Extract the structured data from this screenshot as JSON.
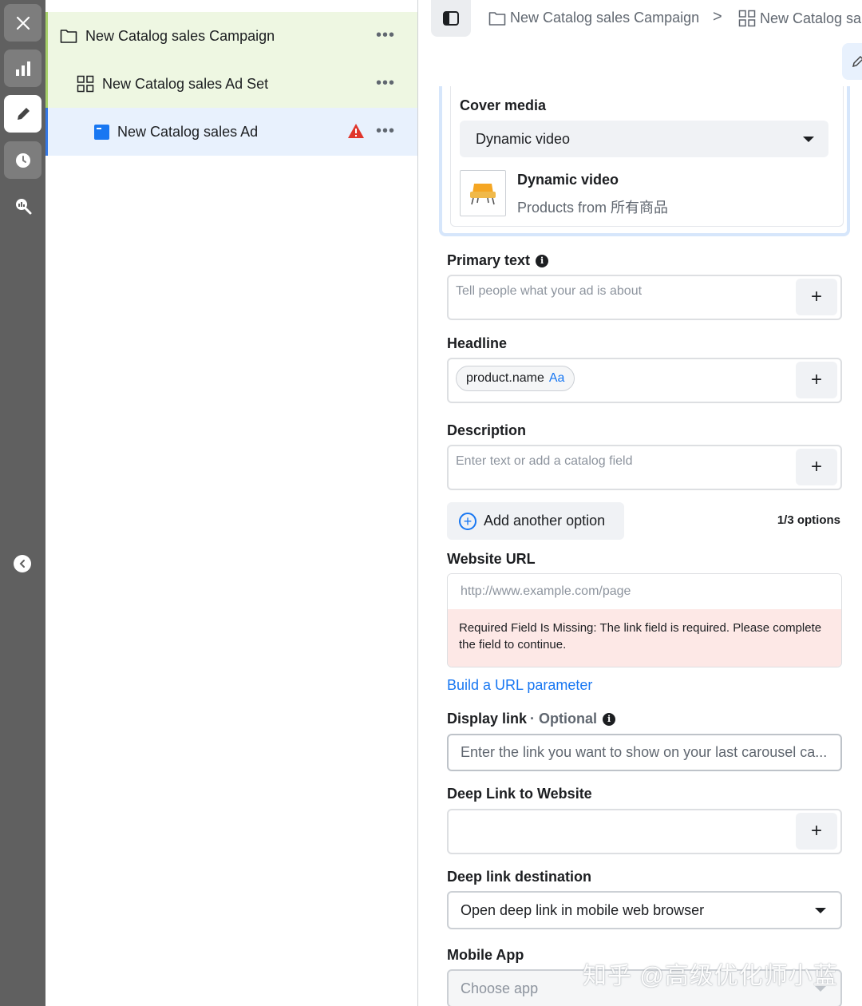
{
  "rail": {
    "items": [
      "close",
      "reporting",
      "edit",
      "history",
      "review"
    ]
  },
  "tree": {
    "campaign": {
      "label": "New Catalog sales Campaign",
      "more": "•••"
    },
    "adset": {
      "label": "New Catalog sales Ad Set",
      "more": "•••"
    },
    "ad": {
      "label": "New Catalog sales Ad",
      "more": "•••",
      "status": "error"
    }
  },
  "breadcrumb": {
    "campaign": "New Catalog sales Campaign",
    "separator": ">",
    "adset": "New Catalog sa"
  },
  "cover_media": {
    "label": "Cover media",
    "selected": "Dynamic video",
    "preview_title": "Dynamic video",
    "preview_subtitle": "Products from 所有商品"
  },
  "primary_text": {
    "label": "Primary text",
    "placeholder": "Tell people what your ad is about",
    "add": "+"
  },
  "headline": {
    "label": "Headline",
    "token": "product.name",
    "token_suffix": "Aa",
    "add": "+"
  },
  "description": {
    "label": "Description",
    "placeholder": "Enter text or add a catalog field",
    "add": "+"
  },
  "options": {
    "add_label": "Add another option",
    "icon": "+",
    "count": "1/3 options"
  },
  "website_url": {
    "label": "Website URL",
    "placeholder": "http://www.example.com/page",
    "error": "Required Field Is Missing: The link field is required. Please complete the field to continue.",
    "build_link": "Build a URL parameter"
  },
  "display_link": {
    "label": "Display link",
    "optional": "· Optional",
    "placeholder": "Enter the link you want to show on your last carousel ca..."
  },
  "deep_link": {
    "label": "Deep Link to Website",
    "add": "+"
  },
  "deep_link_destination": {
    "label": "Deep link destination",
    "selected": "Open deep link in mobile web browser"
  },
  "mobile_app": {
    "label": "Mobile App",
    "placeholder": "Choose app"
  },
  "watermark": "知乎 @高级优化师小蓝",
  "colors": {
    "accent": "#1877f2",
    "error_bg": "#fde8e6",
    "error_icon": "#e0352b",
    "tree_green": "#eef7e2",
    "tree_blue": "#e8f1fd"
  }
}
